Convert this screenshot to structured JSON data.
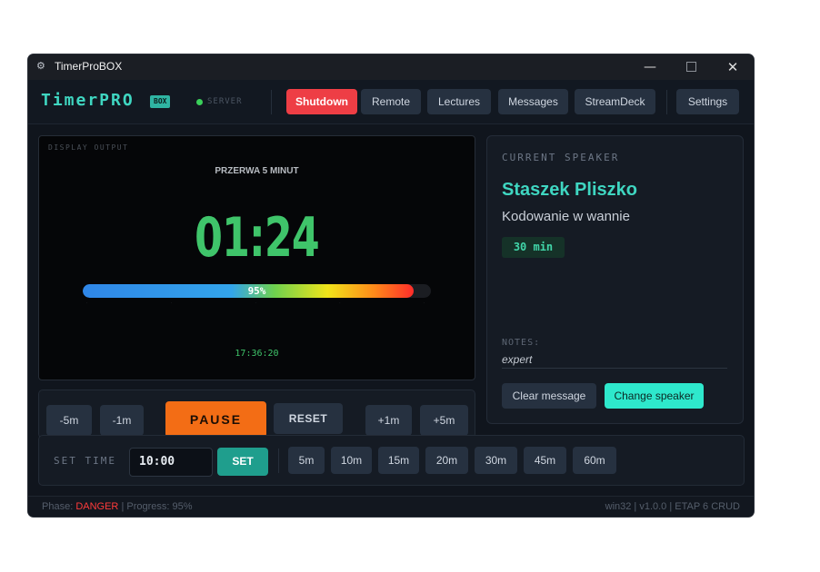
{
  "window": {
    "title": "TimerProBOX",
    "minimize": "—",
    "close": "✕"
  },
  "header": {
    "logo": "TimerPRO",
    "badge": "BOX",
    "server_label": "SERVER",
    "nav": [
      "Shutdown",
      "Remote",
      "Lectures",
      "Messages",
      "StreamDeck",
      "Settings"
    ]
  },
  "display": {
    "label": "DISPLAY OUTPUT",
    "break_text": "PRZERWA 5 MINUT",
    "time": "01:24",
    "progress": 0.95,
    "progress_text": "95%",
    "clock": "17:36:20"
  },
  "speaker": {
    "label": "CURRENT SPEAKER",
    "name": "Staszek Pliszko",
    "topic": "Kodowanie w wannie",
    "duration": "30 min",
    "notes_label": "NOTES:",
    "notes": "expert",
    "clear_button": "Clear message",
    "change_button": "Change speaker"
  },
  "controls": {
    "minus5": "-5m",
    "minus1": "-1m",
    "pause": "PAUSE",
    "reset": "RESET",
    "plus1": "+1m",
    "plus5": "+5m"
  },
  "set_time": {
    "label": "SET TIME",
    "value": "10:00",
    "set_button": "SET",
    "presets": [
      "5m",
      "10m",
      "15m",
      "20m",
      "30m",
      "45m",
      "60m"
    ]
  },
  "status": {
    "phase_prefix": "Phase:",
    "phase": "DANGER",
    "progress_text": "| Progress: 95%",
    "right": "win32 | v1.0.0 | ETAP 6 CRUD"
  },
  "colors": {
    "accent": "#3fd6c1",
    "danger": "#ee3e45",
    "pause": "#f36d15",
    "timer": "#3fc46a"
  }
}
